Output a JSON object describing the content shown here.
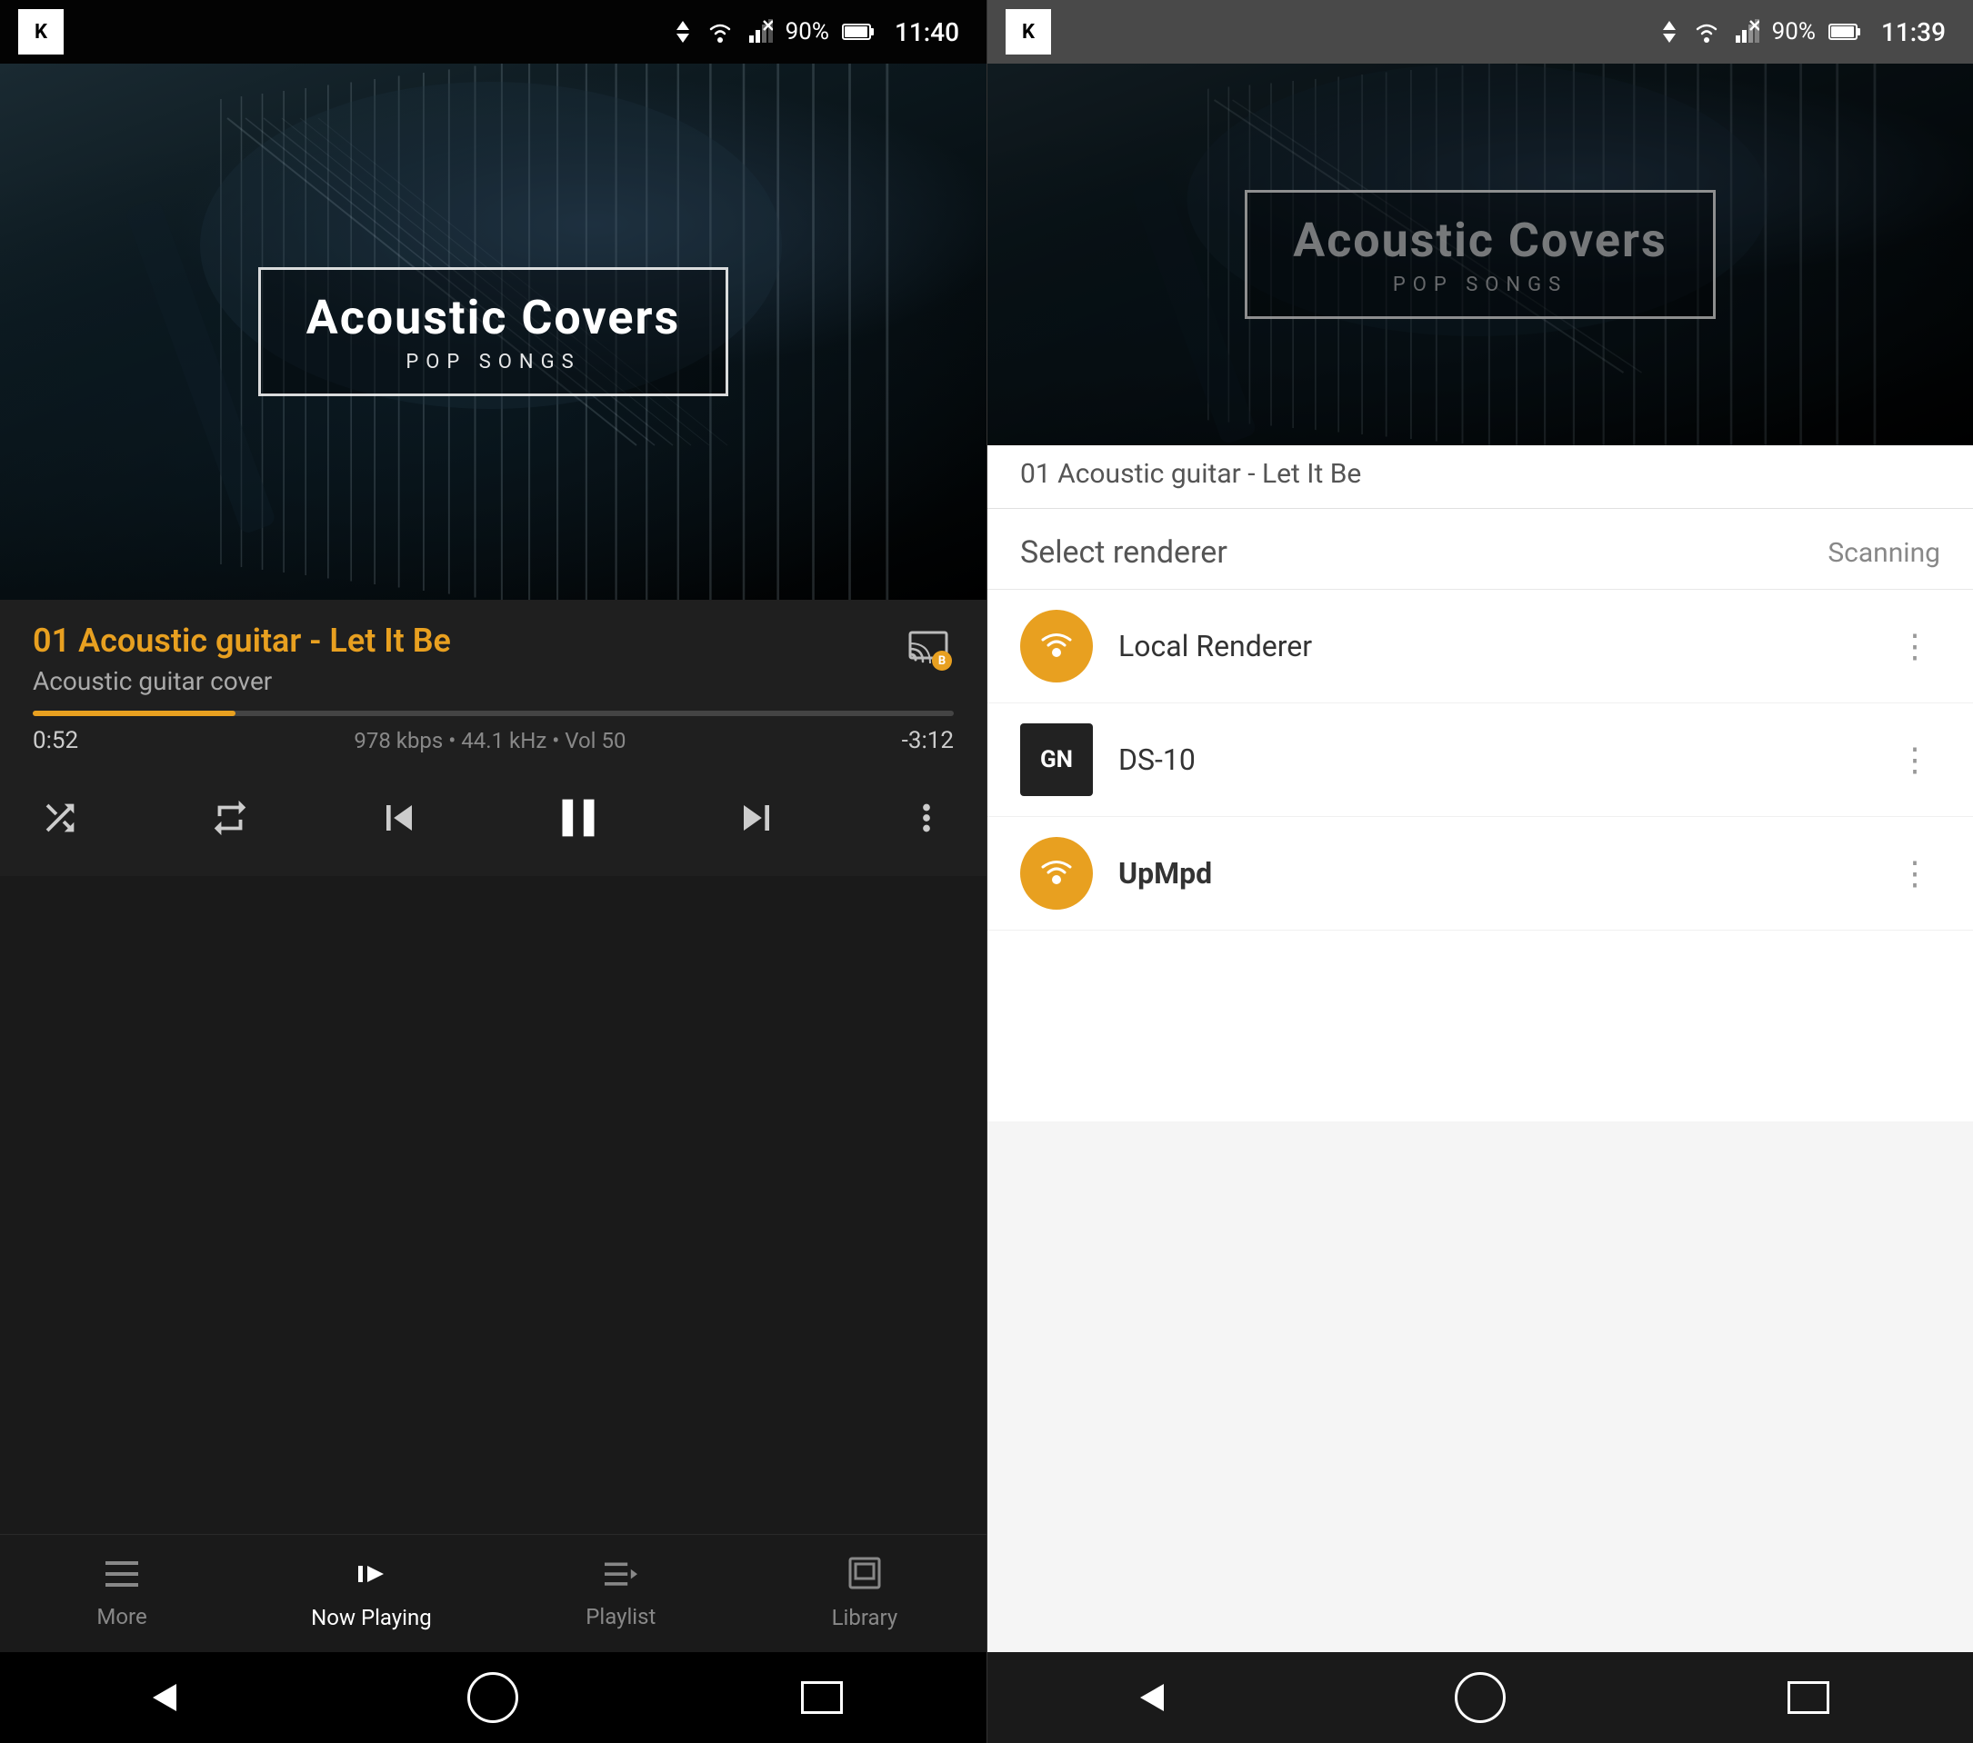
{
  "left": {
    "status": {
      "time": "11:40",
      "battery": "90%",
      "app_icon": "K"
    },
    "album": {
      "title": "Acoustic Covers",
      "subtitle": "POP SONGS"
    },
    "track": {
      "title": "01 Acoustic guitar  - Let It Be",
      "artist": "Acoustic guitar cover",
      "time_elapsed": "0:52",
      "bitrate_info": "978 kbps • 44.1 kHz • Vol 50",
      "time_remaining": "-3:12",
      "progress_percent": 22
    },
    "controls": {
      "shuffle": "⇌",
      "repeat": "↻",
      "prev": "⏮",
      "play_pause": "⏸",
      "next": "⏭",
      "more": "⋮"
    },
    "nav": {
      "items": [
        {
          "id": "more",
          "label": "More",
          "icon": "≡",
          "active": false
        },
        {
          "id": "now-playing",
          "label": "Now Playing",
          "icon": "♪",
          "active": true
        },
        {
          "id": "playlist",
          "label": "Playlist",
          "icon": "≡",
          "active": false
        },
        {
          "id": "library",
          "label": "Library",
          "icon": "▣",
          "active": false
        }
      ]
    }
  },
  "right": {
    "status": {
      "time": "11:39",
      "battery": "90%",
      "app_icon": "K"
    },
    "album": {
      "title": "Acoustic Covers",
      "subtitle": "POP SONGS"
    },
    "partial_track": "01 Acoustic guitar  - Let It Be",
    "renderer": {
      "title": "Select renderer",
      "scanning": "Scanning",
      "items": [
        {
          "id": "local",
          "icon": "B⦿",
          "icon_type": "orange",
          "name": "Local Renderer",
          "bold": false
        },
        {
          "id": "ds10",
          "icon": "GN",
          "icon_type": "dark",
          "name": "DS-10",
          "bold": false
        },
        {
          "id": "upmpd",
          "icon": "B⦿",
          "icon_type": "orange",
          "name": "UpMpd",
          "bold": true
        }
      ]
    }
  }
}
